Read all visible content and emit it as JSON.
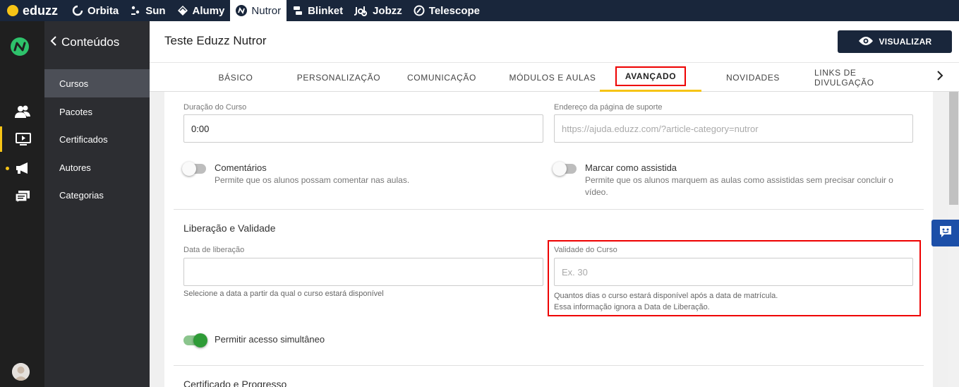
{
  "topbar": {
    "brand": "eduzz",
    "apps": [
      {
        "label": "Orbita",
        "icon": "orbita-icon"
      },
      {
        "label": "Sun",
        "icon": "sun-icon"
      },
      {
        "label": "Alumy",
        "icon": "alumy-icon"
      },
      {
        "label": "Nutror",
        "icon": "nutror-icon"
      },
      {
        "label": "Blinket",
        "icon": "blinket-icon"
      },
      {
        "label": "Jobzz",
        "icon": "jobzz-icon"
      },
      {
        "label": "Telescope",
        "icon": "telescope-icon"
      }
    ],
    "active_app": "Nutror"
  },
  "sidebar": {
    "back_label": "Conteúdos",
    "items": [
      {
        "label": "Cursos"
      },
      {
        "label": "Pacotes"
      },
      {
        "label": "Certificados"
      },
      {
        "label": "Autores"
      },
      {
        "label": "Categorias"
      }
    ],
    "active_item": "Cursos"
  },
  "header": {
    "title": "Teste Eduzz Nutror",
    "visualize_label": "VISUALIZAR"
  },
  "tabs": [
    {
      "label": "BÁSICO"
    },
    {
      "label": "PERSONALIZAÇÃO"
    },
    {
      "label": "COMUNICAÇÃO"
    },
    {
      "label": "MÓDULOS E AULAS"
    },
    {
      "label": "AVANÇADO"
    },
    {
      "label": "NOVIDADES"
    },
    {
      "label": "LINKS DE DIVULGAÇÃO"
    }
  ],
  "active_tab": "AVANÇADO",
  "form": {
    "duration_label": "Duração do Curso",
    "duration_value": "0:00",
    "support_label": "Endereço da página de suporte",
    "support_placeholder": "https://ajuda.eduzz.com/?article-category=nutror",
    "comments_title": "Comentários",
    "comments_desc": "Permite que os alunos possam comentar nas aulas.",
    "comments_on": false,
    "watched_title": "Marcar como assistida",
    "watched_desc": "Permite que os alunos marquem as aulas como assistidas sem precisar concluir o vídeo.",
    "watched_on": false,
    "release_section": "Liberação e Validade",
    "release_label": "Data de liberação",
    "release_value": "",
    "release_help": "Selecione a data a partir da qual o curso estará disponível",
    "validity_label": "Validade do Curso",
    "validity_placeholder": "Ex. 30",
    "validity_help_1": "Quantos dias o curso estará disponível após a data de matrícula.",
    "validity_help_2": "Essa informação ignora a Data de Liberação.",
    "simultaneous_title": "Permitir acesso simultâneo",
    "simultaneous_on": true,
    "certificate_section": "Certificado e Progresso"
  },
  "colors": {
    "topbar": "#19263b",
    "accent": "#f6c416",
    "highlight": "#e00000",
    "switch_on": "#2e9b37",
    "chat": "#1c4fa8"
  }
}
